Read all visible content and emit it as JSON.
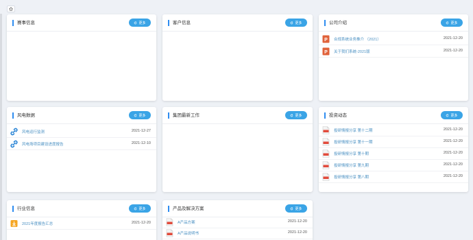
{
  "home_icon": "home-icon",
  "more_icon": "refresh-icon",
  "accent_color": "#3aa4e6",
  "cards": [
    {
      "title": "赛事信息",
      "more_label": "更多",
      "items": []
    },
    {
      "title": "客户信息",
      "more_label": "更多",
      "items": []
    },
    {
      "title": "公司介绍",
      "more_label": "更多",
      "items": [
        {
          "icon": "ppt-icon",
          "text": "合规系统业务推介 （2021）",
          "date": "2021-12-20"
        },
        {
          "icon": "ppt-icon",
          "text": "关于我们系统-2021版",
          "date": "2021-12-20"
        }
      ]
    },
    {
      "title": "风电数据",
      "more_label": "更多",
      "items": [
        {
          "icon": "link-icon",
          "text": "风电运行监测",
          "date": "2021-12-27"
        },
        {
          "icon": "link-icon",
          "text": "风电场项目建设进度报告",
          "date": "2021-12-10"
        }
      ]
    },
    {
      "title": "集团最新工作",
      "more_label": "更多",
      "items": []
    },
    {
      "title": "投资动态",
      "more_label": "更多",
      "items": [
        {
          "icon": "pdf-icon",
          "text": "投研情报分享 第十二期",
          "date": "2021-12-20"
        },
        {
          "icon": "pdf-icon",
          "text": "投研情报分享 第十一期",
          "date": "2021-12-20"
        },
        {
          "icon": "pdf-icon",
          "text": "投研情报分享 第十期",
          "date": "2021-12-20"
        },
        {
          "icon": "pdf-icon",
          "text": "投研情报分享 第九期",
          "date": "2021-12-20"
        },
        {
          "icon": "pdf-icon",
          "text": "投研情报分享 第八期",
          "date": "2021-12-20"
        }
      ]
    },
    {
      "title": "行业信息",
      "more_label": "更多",
      "items": [
        {
          "icon": "download-icon",
          "text": "2021年度报告汇总",
          "date": "2021-12-20"
        }
      ]
    },
    {
      "title": "产品及解决方案",
      "more_label": "更多",
      "items": [
        {
          "icon": "pdf-icon",
          "text": "A产品方案",
          "date": "2021-12-20"
        },
        {
          "icon": "pdf-icon",
          "text": "A产品说明书",
          "date": "2021-12-20"
        }
      ]
    }
  ]
}
